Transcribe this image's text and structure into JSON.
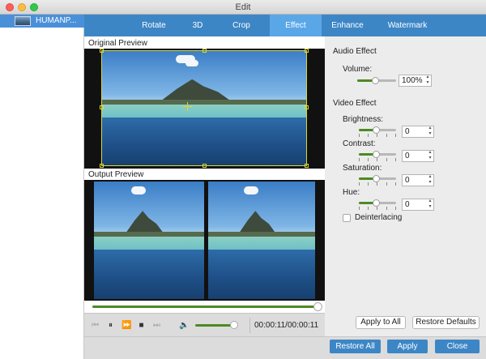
{
  "window": {
    "title": "Edit"
  },
  "sidebar": {
    "file_name": "HUMANP..."
  },
  "tabs": [
    {
      "label": "Rotate"
    },
    {
      "label": "3D"
    },
    {
      "label": "Crop"
    },
    {
      "label": "Effect"
    },
    {
      "label": "Enhance"
    },
    {
      "label": "Watermark"
    }
  ],
  "active_tab": "Effect",
  "preview": {
    "original_label": "Original Preview",
    "output_label": "Output Preview"
  },
  "player": {
    "seek_progress": 1.0,
    "volume_level": 0.88,
    "time": "00:00:11/00:00:11",
    "icons": [
      "skip-back-icon",
      "pause-icon",
      "fast-forward-icon",
      "stop-icon",
      "skip-end-icon",
      "speaker-icon"
    ]
  },
  "audio_effect": {
    "title": "Audio Effect",
    "volume_label": "Volume:",
    "volume_value": "100%",
    "volume_level": 0.5
  },
  "video_effect": {
    "title": "Video Effect",
    "brightness_label": "Brightness:",
    "brightness_value": "0",
    "contrast_label": "Contrast:",
    "contrast_value": "0",
    "saturation_label": "Saturation:",
    "saturation_value": "0",
    "hue_label": "Hue:",
    "hue_value": "0",
    "deinterlacing_label": "Deinterlacing",
    "deinterlacing_checked": false
  },
  "buttons": {
    "apply_to_all": "Apply to All",
    "restore_defaults": "Restore Defaults",
    "restore_all": "Restore All",
    "apply": "Apply",
    "close": "Close"
  },
  "colors": {
    "tab_bar": "#3d86c6",
    "active_tab": "#5aa7e8",
    "slider_fill": "#4d8a24",
    "crop_outline": "#d8d838"
  }
}
